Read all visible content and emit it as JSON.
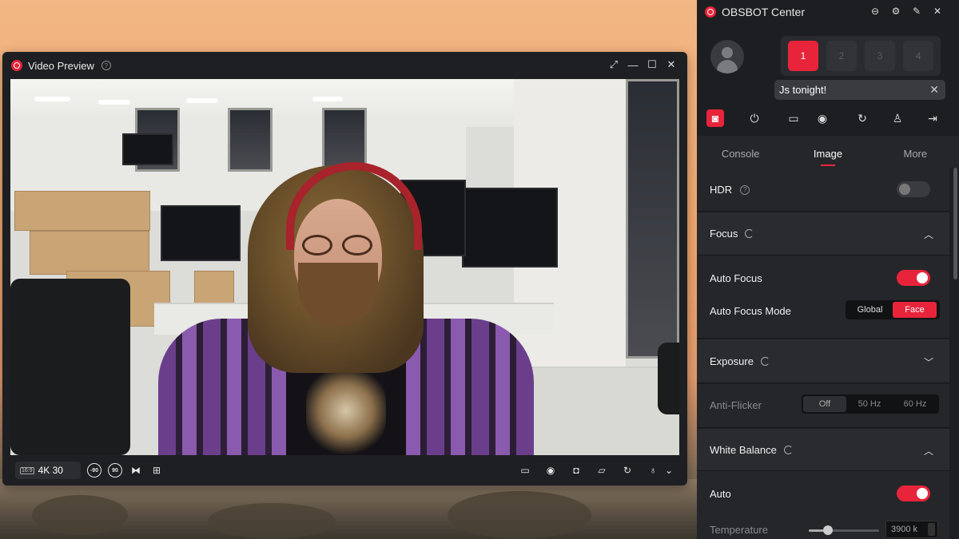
{
  "preview": {
    "title": "Video Preview",
    "resolution": "4K 30",
    "aspect": "16:9",
    "icons": {
      "help": "?",
      "rotate_left": "-90",
      "rotate_right": "90"
    }
  },
  "panel": {
    "title": "OBSBOT Center",
    "presets": [
      "1",
      "2",
      "3",
      "4"
    ],
    "active_preset": "1",
    "toast": "Js tonight!",
    "tabs": [
      "Console",
      "Image",
      "More"
    ],
    "active_tab": "Image",
    "hdr": {
      "label": "HDR",
      "on": false
    },
    "focus": {
      "label": "Focus",
      "auto_focus": {
        "label": "Auto Focus",
        "on": true
      },
      "mode": {
        "label": "Auto Focus Mode",
        "options": [
          "Global",
          "Face"
        ],
        "selected": "Face"
      }
    },
    "exposure": {
      "label": "Exposure",
      "anti_flicker": {
        "label": "Anti-Flicker",
        "options": [
          "Off",
          "50 Hz",
          "60 Hz"
        ],
        "selected": "Off"
      }
    },
    "white_balance": {
      "label": "White Balance",
      "auto": {
        "label": "Auto",
        "on": true
      },
      "temperature": {
        "label": "Temperature",
        "value": "3900 k",
        "level": 0.27
      }
    }
  },
  "colors": {
    "accent": "#e8243b",
    "panel_bg": "#1d1e21",
    "section_bg": "#25262a"
  }
}
